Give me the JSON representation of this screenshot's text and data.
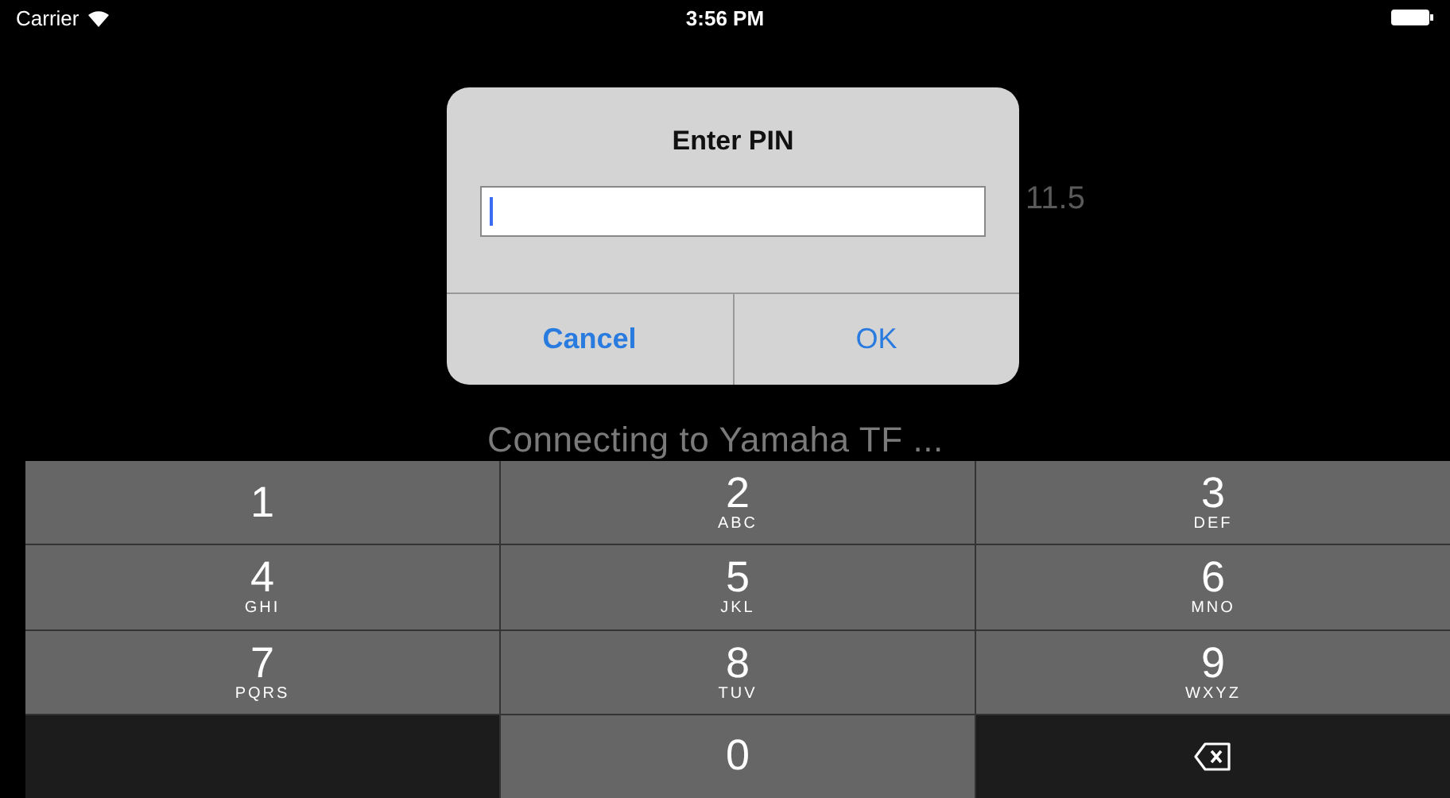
{
  "status_bar": {
    "carrier": "Carrier",
    "time": "3:56 PM"
  },
  "background": {
    "reading": "11.5"
  },
  "dialog": {
    "title": "Enter PIN",
    "buttons": [
      "Cancel",
      "OK"
    ]
  },
  "status_message": "Connecting to Yamaha TF ...",
  "keypad": [
    {
      "kind": "digit",
      "digit": "1"
    },
    {
      "kind": "digit",
      "digit": "2",
      "letters": "ABC"
    },
    {
      "kind": "digit",
      "digit": "3",
      "letters": "DEF"
    },
    {
      "kind": "digit",
      "digit": "4",
      "letters": "GHI"
    },
    {
      "kind": "digit",
      "digit": "5",
      "letters": "JKL"
    },
    {
      "kind": "digit",
      "digit": "6",
      "letters": "MNO"
    },
    {
      "kind": "digit",
      "digit": "7",
      "letters": "PQRS"
    },
    {
      "kind": "digit",
      "digit": "8",
      "letters": "TUV"
    },
    {
      "kind": "digit",
      "digit": "9",
      "letters": "WXYZ"
    },
    {
      "kind": "blank"
    },
    {
      "kind": "digit",
      "digit": "0"
    },
    {
      "kind": "delete"
    }
  ]
}
